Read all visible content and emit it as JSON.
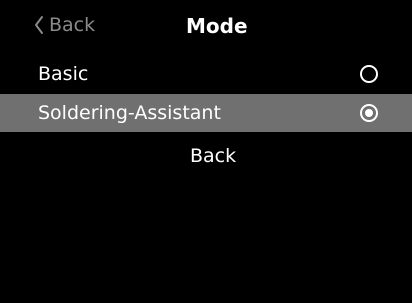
{
  "header": {
    "back_label": "Back",
    "back_icon": "chevron-left-icon",
    "title": "Mode"
  },
  "options": [
    {
      "label": "Basic",
      "selected": false
    },
    {
      "label": "Soldering-Assistant",
      "selected": true
    }
  ],
  "back_item_label": "Back",
  "colors": {
    "background": "#000000",
    "text": "#ffffff",
    "muted_text": "#8a8a8a",
    "highlight_row": "#707070"
  }
}
